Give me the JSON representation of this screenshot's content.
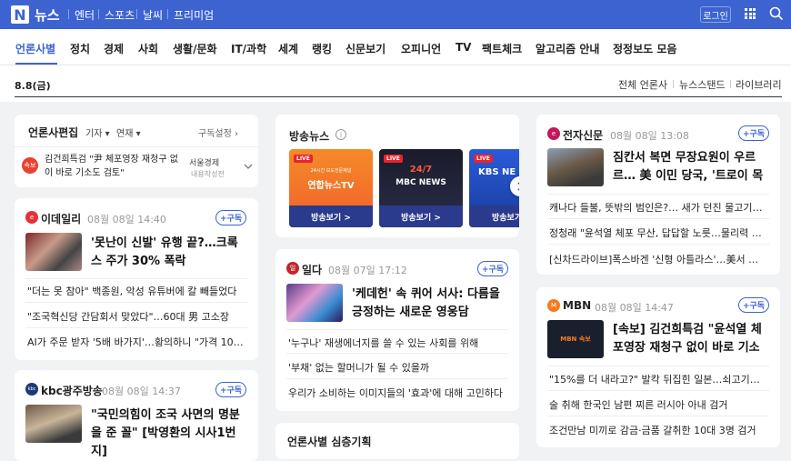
{
  "topbar": {
    "logo_letter": "N",
    "logo_text": "뉴스",
    "services": [
      "엔터",
      "스포츠",
      "날씨",
      "프리미엄"
    ],
    "login_label": "로그인"
  },
  "nav": {
    "items": [
      "언론사별",
      "정치",
      "경제",
      "사회",
      "생활/문화",
      "IT/과학",
      "세계",
      "랭킹",
      "신문보기",
      "오피니언",
      "TV",
      "팩트체크",
      "알고리즘 안내",
      "정정보도 모음"
    ]
  },
  "subheader": {
    "date": "8.8(금)",
    "links": [
      "전체 언론사",
      "뉴스스탠드",
      "라이브러리"
    ]
  },
  "editor_card": {
    "title": "언론사편집",
    "filter1": "기자",
    "filter2": "연재",
    "subscribe_settings": "구독설정",
    "badge": "속보",
    "headline": "김건희특검 \"尹 체포영장 재청구 없이 바로 기소도 검토\"",
    "press": "서울경제",
    "press_sub": "내용작성전"
  },
  "edaily": {
    "logo_text": "e",
    "press": "이데일리",
    "time": "08월 08일 14:40",
    "subscribe": "+구독",
    "headline": "'못난이 신발' 유행 끝?…크록스 주가 30% 폭락",
    "items": [
      "\"더는 못 참아\" 백종원, 악성 유튜버에 칼 빼들었다",
      "\"조국혁신당 간담회서 맞았다\"…60대 男 고소장",
      "AI가 주문 받자 '5배 바가지'…황의하니 \"가격 100배\""
    ]
  },
  "kbc": {
    "logo_text": "kbc",
    "press": "kbc광주방송",
    "time": "08월 08일 14:37",
    "subscribe": "+구독",
    "headline": "\"국민의힘이 조국 사면의 명분을 준 꼴\" [박영환의 시사1번지]"
  },
  "broadcast": {
    "title": "방송뉴스",
    "info_icon": "i",
    "tiles": [
      {
        "live": "LIVE",
        "caption": "24시간 보도전문채널",
        "name": "연합뉴스TV",
        "button": "방송보기 >"
      },
      {
        "live": "LIVE",
        "caption": "24/7",
        "name": "MBC NEWS",
        "button": "방송보기 >"
      },
      {
        "live": "LIVE",
        "caption": "",
        "name": "KBS NE",
        "button": "방송보기"
      }
    ]
  },
  "ilda": {
    "logo_text": "일",
    "press": "일다",
    "time": "08월 07일 17:12",
    "subscribe": "+구독",
    "headline": "'케데헌' 속 퀴어 서사: 다름을 긍정하는 새로운 영웅담",
    "items": [
      "'누구나' 재생에너지를 쓸 수 있는 사회를 위해",
      "'부채' 없는 할머니가 될 수 있을까",
      "우리가 소비하는 이미지들의 '효과'에 대해 고민하다"
    ]
  },
  "special": {
    "title": "언론사별 심층기획"
  },
  "etnews": {
    "logo_text": "e",
    "press": "전자신문",
    "time": "08월 08일 13:08",
    "subscribe": "+구독",
    "headline": "짐칸서 복면 무장요원이 우르르… 美 이민 당국, '트로이 목마' 작전",
    "items": [
      "캐나다 들불, 뜻밖의 범인은?… 새가 던진 물고기가 원인",
      "정청래 \"윤석열 체포 무산, 답답할 노릇…물리력 행사해야\"",
      "[신차드라이브]폭스바겐 '신형 아틀라스'…美서 인기 SUV"
    ]
  },
  "mbn": {
    "logo_text": "M",
    "press": "MBN",
    "time": "08월 08일 14:47",
    "subscribe": "+구독",
    "thumb_text": "MBN 속보",
    "headline": "[속보] 김건희특검 \"윤석열 체포영장 재청구 없이 바로 기소도 검토\"",
    "items": [
      "\"15%를 더 내라고?\" 발칵 뒤집힌 일본…쇠고기엔 관세",
      "술 취해 한국인 남편 찌른 러시아 아내 검거",
      "조건만남 미끼로 감금·금품 갈취한 10대 3명 검거"
    ]
  },
  "colors": {
    "brand": "#3d63d1",
    "badge_red": "#e8432e"
  }
}
